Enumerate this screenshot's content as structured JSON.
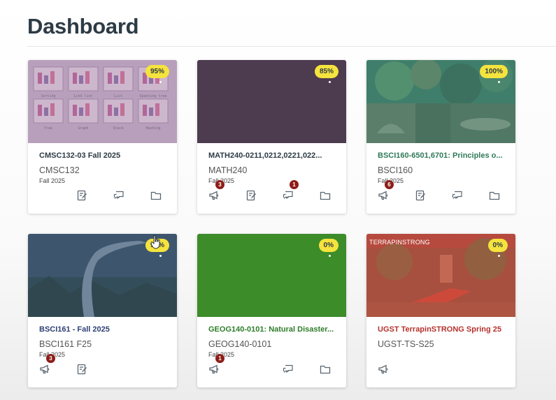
{
  "page": {
    "title": "Dashboard"
  },
  "colors": {
    "grade_badge": "#f5e33e",
    "count_badge": "#8c1d18",
    "text_primary": "#2d3b45"
  },
  "cards": [
    {
      "name": "CMSC132-03 Fall 2025",
      "name_color": "#2d3b45",
      "code": "CMSC132",
      "term": "Fall 2025",
      "grade": "95%",
      "hero": "diagram-collage",
      "hero_color": "#b79ab6",
      "actions": [
        {
          "icon": "assignments-icon",
          "count": null
        },
        {
          "icon": "files-icon",
          "count": null
        },
        {
          "icon": "discussions-icon",
          "count": null
        }
      ],
      "hero_labels": [
        "Sorting",
        "Link list",
        "List",
        "Spanning tree",
        "Tree",
        "Graph",
        "Stack",
        "Hashing"
      ]
    },
    {
      "name": "MATH240-0211,0212,0221,022...",
      "name_color": "#2d3b45",
      "code": "MATH240",
      "term": "Fall 2025",
      "grade": "85%",
      "hero": "solid",
      "hero_color": "#4d3b4f",
      "actions": [
        {
          "icon": "announcements-icon",
          "count": "3"
        },
        {
          "icon": "assignments-icon",
          "count": null
        },
        {
          "icon": "discussions-icon",
          "count": "1"
        },
        {
          "icon": "files-icon",
          "count": null
        }
      ]
    },
    {
      "name": "BSCI160-6501,6701: Principles o...",
      "name_color": "#2f7a5a",
      "code": "BSCI160",
      "term": "Fall 2025",
      "grade": "100%",
      "hero": "biology-collage",
      "hero_color": "#3f7e6a",
      "actions": [
        {
          "icon": "announcements-icon",
          "count": "6"
        },
        {
          "icon": "assignments-icon",
          "count": null
        },
        {
          "icon": "discussions-icon",
          "count": null
        },
        {
          "icon": "files-icon",
          "count": null
        }
      ]
    },
    {
      "name": "BSCI161 - Fall 2025",
      "name_color": "#2f3f75",
      "code": "BSCI161 F25",
      "term": "Fall 2025",
      "grade": "97%",
      "hero": "heron-photo",
      "hero_color": "#3d5670",
      "actions": [
        {
          "icon": "announcements-icon",
          "count": "3"
        },
        {
          "icon": "assignments-icon",
          "count": null
        }
      ]
    },
    {
      "name": "GEOG140-0101: Natural Disaster...",
      "name_color": "#2e7d2a",
      "code": "GEOG140-0101",
      "term": "Fall 2025",
      "grade": "0%",
      "hero": "solid",
      "hero_color": "#3c8c2a",
      "actions": [
        {
          "icon": "announcements-icon",
          "count": "1"
        },
        {
          "icon": "discussions-icon",
          "count": null
        },
        {
          "icon": "files-icon",
          "count": null
        }
      ]
    },
    {
      "name": "UGST TerrapinSTRONG Spring 25",
      "name_color": "#b5322d",
      "code": "UGST-TS-S25",
      "term": "",
      "grade": "0%",
      "hero": "campus-photo",
      "hero_color": "#b84a3e",
      "hero_tag": "TERRAPINSTRONG",
      "actions": [
        {
          "icon": "announcements-icon",
          "count": null
        }
      ]
    }
  ]
}
